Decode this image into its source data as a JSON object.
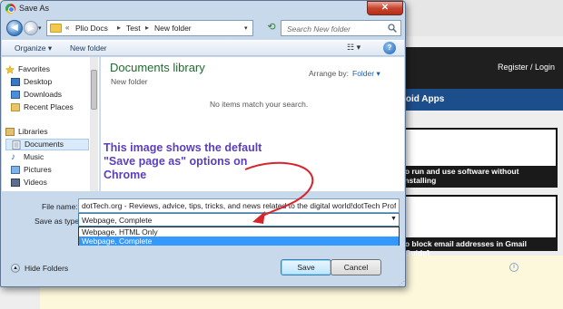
{
  "background": {
    "nav_links": "Register / Login",
    "section_title": "roid Apps",
    "card1_caption": "to run and use software without installing",
    "card1_caption_suffix": "]",
    "card2_caption": "to block email addresses in Gmail [Guide]",
    "info_icon": "i"
  },
  "dialog": {
    "title": "Save As",
    "close_label": "✕",
    "breadcrumb": [
      "Plio Docs",
      "Test",
      "New folder"
    ],
    "breadcrumb_prefix": "«",
    "search_placeholder": "Search New folder",
    "toolbar": {
      "organize": "Organize ▾",
      "new_folder": "New folder",
      "views": "☷ ▾",
      "help": "?"
    },
    "nav_pane": {
      "favorites_label": "Favorites",
      "favorites": [
        "Desktop",
        "Downloads",
        "Recent Places"
      ],
      "libraries_label": "Libraries",
      "libraries": [
        "Documents",
        "Music",
        "Pictures",
        "Videos"
      ]
    },
    "content": {
      "library_title": "Documents library",
      "library_subtitle": "New folder",
      "arrange_by_label": "Arrange by:",
      "arrange_by_value": "Folder ▾",
      "empty_message": "No items match your search."
    },
    "form": {
      "file_name_label": "File name:",
      "file_name_value": "dotTech.org - Reviews, advice, tips, tricks, and news related to the digital world!dotTech  Professi",
      "save_as_type_label": "Save as type:",
      "save_as_type_value": "Webpage, Complete",
      "save_as_type_options": [
        "Webpage, HTML Only",
        "Webpage, Complete"
      ]
    },
    "footer": {
      "hide_folders": "Hide Folders",
      "save": "Save",
      "cancel": "Cancel"
    }
  },
  "annotation": {
    "lines": [
      "This image shows the default",
      "\"Save page as\" options on",
      "Chrome"
    ],
    "color": "#5b3fb8",
    "arrow_color": "#d7262b"
  }
}
